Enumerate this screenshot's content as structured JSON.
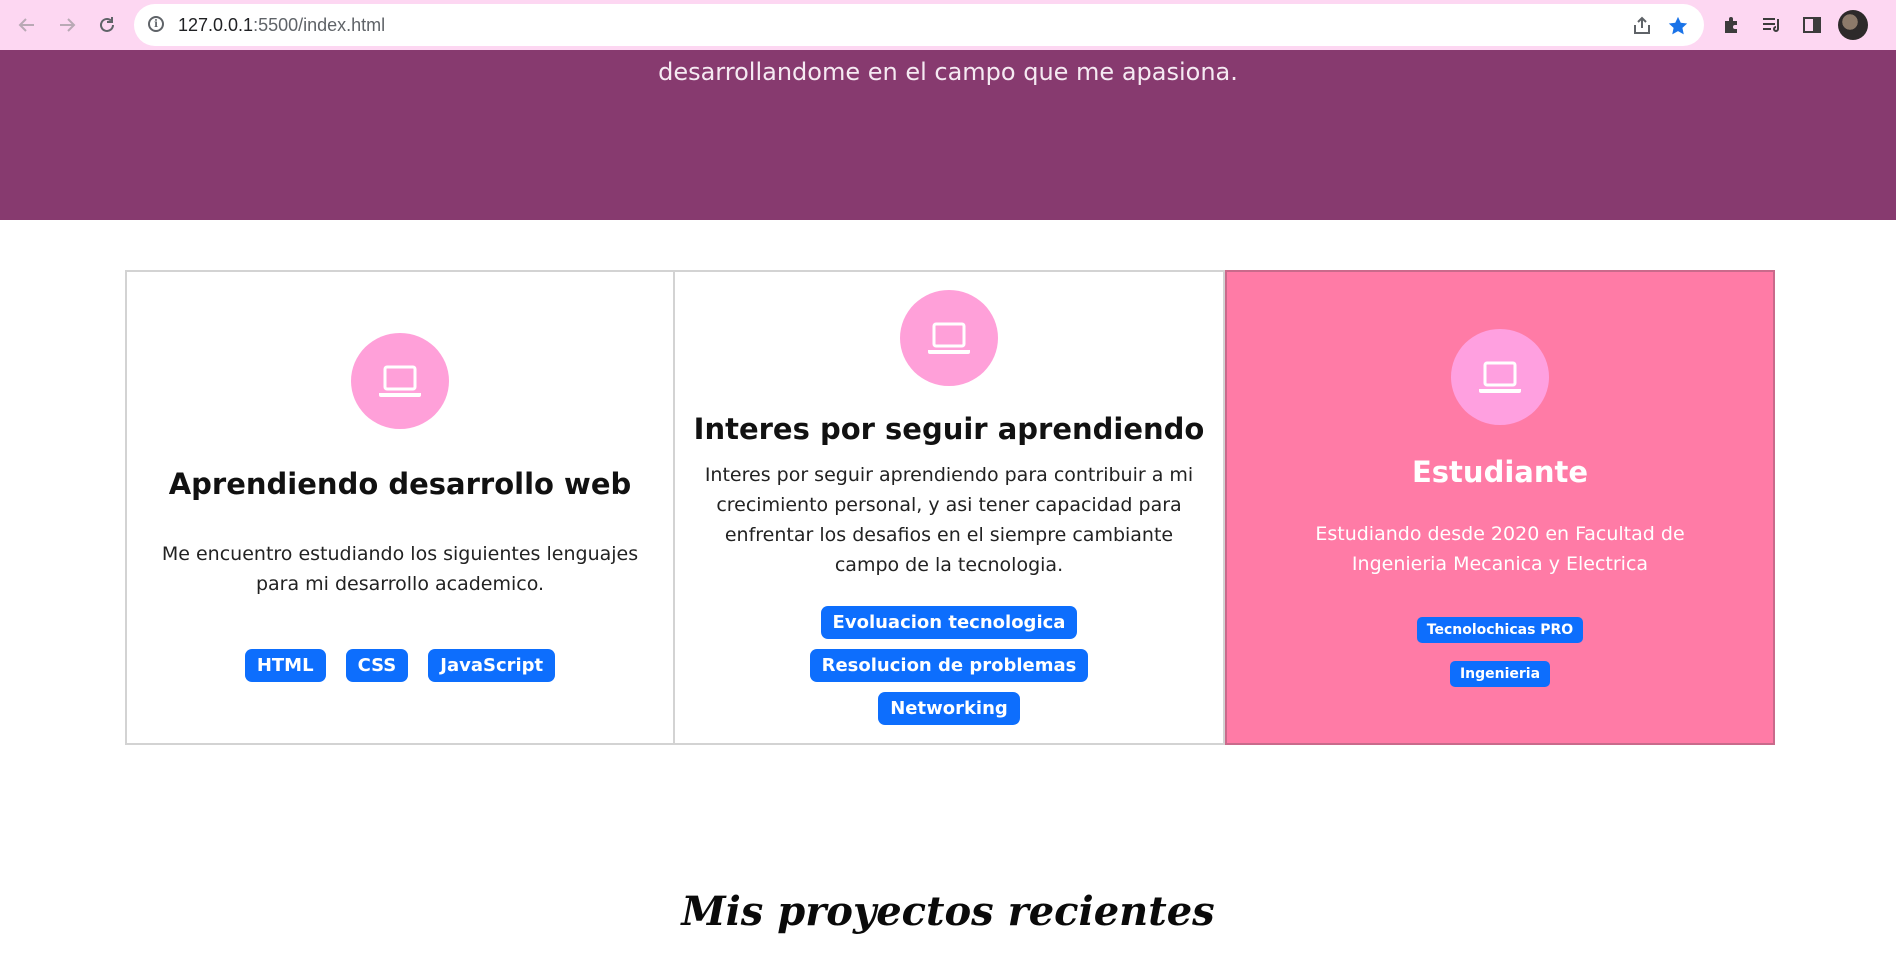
{
  "browser": {
    "back_icon": "arrow-left-icon",
    "forward_icon": "arrow-right-icon",
    "reload_icon": "reload-icon",
    "url_host": "127.0.0.1",
    "url_rest": ":5500/index.html",
    "bookmark_color": "#1a73e8"
  },
  "hero": {
    "text_line": "desarrollandome en el campo que me apasiona.",
    "background": "#873a6f"
  },
  "cards": [
    {
      "title": "Aprendiendo desarrollo web",
      "description": "Me encuentro estudiando los siguientes lenguajes para mi desarrollo academico.",
      "tags": [
        "HTML",
        "CSS",
        "JavaScript"
      ],
      "icon": "laptop-icon"
    },
    {
      "title": "Interes por seguir aprendiendo",
      "description": "Interes por seguir aprendiendo para contribuir a mi crecimiento personal, y asi tener capacidad para enfrentar los desafios en el siempre cambiante campo de la tecnologia.",
      "tags": [
        "Evoluacion tecnologica",
        "Resolucion de problemas",
        "Networking"
      ],
      "icon": "laptop-icon"
    },
    {
      "title": "Estudiante",
      "description": "Estudiando desde 2020 en Facultad de Ingenieria Mecanica y Electrica",
      "tags": [
        "Tecnolochicas PRO",
        "Ingenieria"
      ],
      "icon": "laptop-icon",
      "background": "#ff7ba6"
    }
  ],
  "section": {
    "title": "Mis proyectos recientes"
  },
  "colors": {
    "tag": "#0d6efd",
    "icon_circle": "#ffa0d9"
  }
}
